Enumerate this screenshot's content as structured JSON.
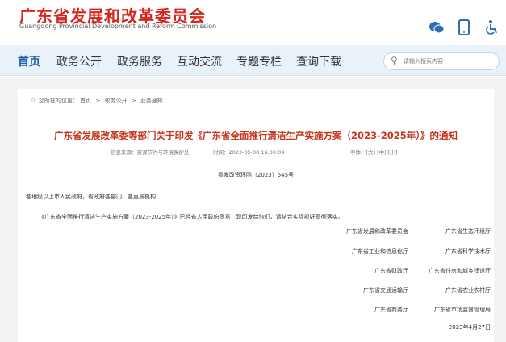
{
  "header": {
    "logo_cn": "广东省发展和改革委员会",
    "logo_en": "Guangdong Provincial Development and Reform Commission",
    "icons": [
      "wechat-icon",
      "mobile-icon",
      "accessibility-icon"
    ]
  },
  "nav": {
    "items": [
      "首页",
      "政务公开",
      "政务服务",
      "互动交流",
      "专题专栏",
      "查询下载"
    ],
    "active": "首页",
    "search_placeholder": "请输入搜索内容"
  },
  "breadcrumb": {
    "prefix": "您所在的位置：",
    "items": [
      "首页",
      "政务公开",
      "业务通知"
    ],
    "separator": ">"
  },
  "article": {
    "title": "广东省发展改革委等部门关于印发《广东省全面推行清洁生产实施方案（2023-2025年）》的通知",
    "source": "信息来源：资源节约与环境保护处",
    "time": "时间：2023-05-08 16:30:09",
    "font_size": "字体：[大] [中] [小]",
    "doc_number": "粤发改资环函〔2023〕545号",
    "addressee": "各地级以上市人民政府，省政府各部门、各直属机构：",
    "body": "《广东省全面推行清洁生产实施方案（2023-2025年）》已经省人民政府同意，现印发给你们，请结合实际抓好贯彻落实。",
    "signers": [
      [
        "广东省发展和改革委员会",
        "广东省生态环境厅"
      ],
      [
        "广东省工业和信息化厅",
        "广东省科学技术厅"
      ],
      [
        "广东省财政厅",
        "广东省住房和城乡建设厅"
      ],
      [
        "广东省交通运输厅",
        "广东省农业农村厅"
      ],
      [
        "广东省商务厅",
        "广东省市场监督管理局"
      ]
    ],
    "date": "2023年4月27日"
  },
  "colors": {
    "brand_red": "#d4261c",
    "title_red": "#c8331c",
    "nav_blue": "#1c5fa8",
    "nav_bg": "#e9f1f9"
  }
}
